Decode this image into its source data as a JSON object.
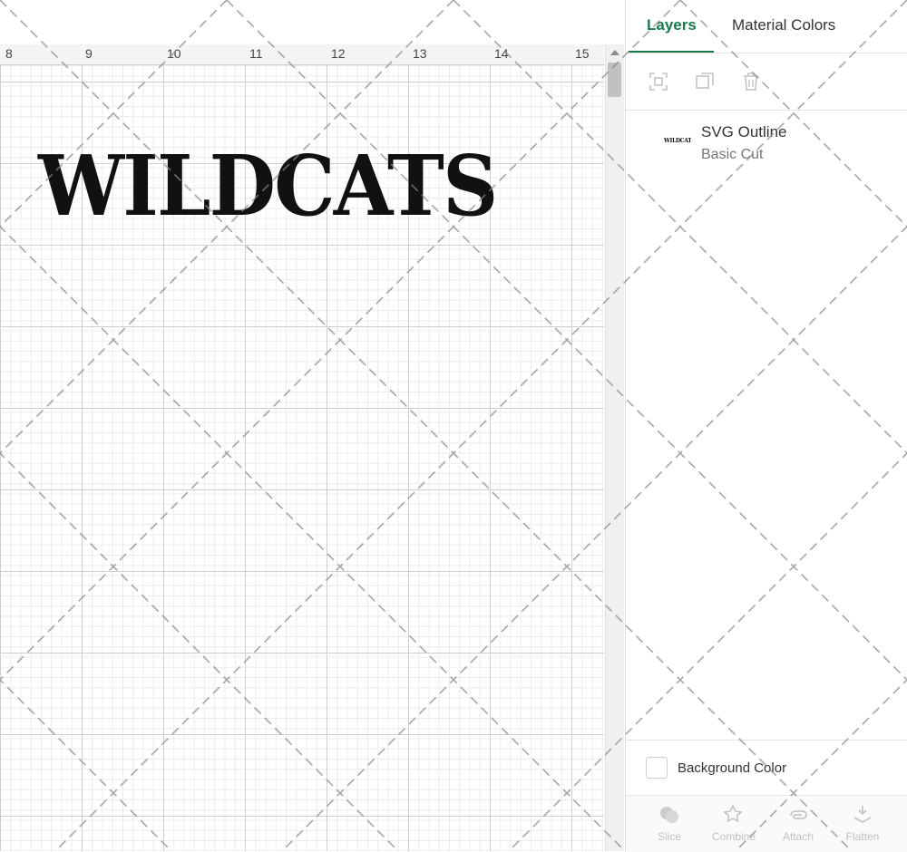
{
  "canvas": {
    "ruler_labels": [
      "8",
      "9",
      "10",
      "11",
      "12",
      "13",
      "14",
      "15"
    ],
    "design_text": "WILDCATS"
  },
  "panel": {
    "tabs": [
      {
        "label": "Layers",
        "active": true
      },
      {
        "label": "Material Colors",
        "active": false
      }
    ],
    "tools": [
      "group-icon",
      "duplicate-icon",
      "delete-icon"
    ],
    "layer": {
      "thumbnail_text": "WILDCATS",
      "name": "SVG Outline",
      "operation": "Basic Cut"
    },
    "background_color_label": "Background Color",
    "bottom_actions": [
      {
        "label": "Slice",
        "icon": "slice-icon"
      },
      {
        "label": "Combine",
        "icon": "combine-icon"
      },
      {
        "label": "Attach",
        "icon": "attach-icon"
      },
      {
        "label": "Flatten",
        "icon": "flatten-icon"
      }
    ]
  },
  "colors": {
    "accent": "#1b7a4d",
    "text": "#333333",
    "grid_major": "#cfcfcf",
    "grid_minor": "#ececec"
  }
}
